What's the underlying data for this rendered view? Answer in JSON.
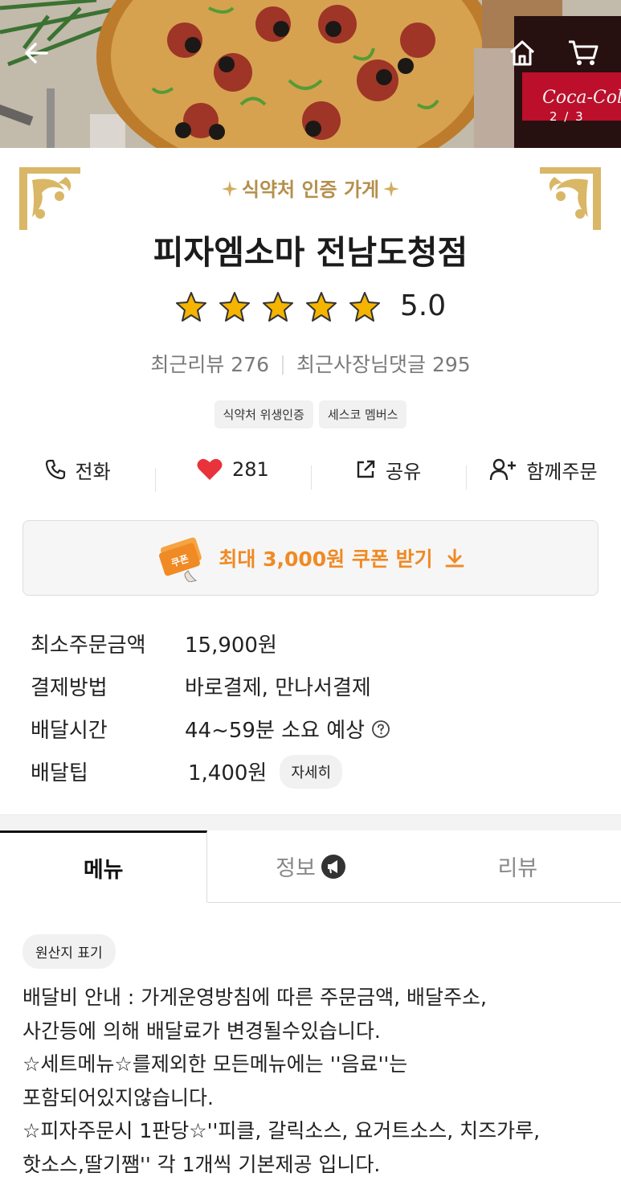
{
  "hero": {
    "image_counter": "2 / 3",
    "back_icon": "arrow-left-icon",
    "home_icon": "home-icon",
    "cart_icon": "cart-icon"
  },
  "store": {
    "certification": "식약처 인증 가게",
    "name": "피자엠소마 전남도청점",
    "rating_stars": 5,
    "rating": "5.0",
    "recent_reviews": "최근리뷰 276",
    "owner_replies": "최근사장님댓글 295",
    "badges": [
      "식약처 위생인증",
      "세스코 멤버스"
    ]
  },
  "actions": {
    "call": "전화",
    "likes": "281",
    "share": "공유",
    "group_order": "함께주문"
  },
  "coupon": {
    "label": "최대 3,000원 쿠폰 받기",
    "ticket_text": "쿠폰"
  },
  "info": {
    "min_order_key": "최소주문금액",
    "min_order_val": "15,900원",
    "payment_key": "결제방법",
    "payment_val": "바로결제, 만나서결제",
    "delivery_time_key": "배달시간",
    "delivery_time_val": "44~59분 소요 예상",
    "delivery_tip_key": "배달팁",
    "delivery_tip_val": "1,400원",
    "detail_button": "자세히"
  },
  "tabs": {
    "menu": "메뉴",
    "info": "정보",
    "review": "리뷰"
  },
  "notice": {
    "origin_chip": "원산지 표기",
    "text": "배달비 안내 :  가게운영방침에 따른 주문금액, 배달주소,\n사간등에 의해 배달료가 변경될수있습니다.\n☆세트메뉴☆를제외한 모든메뉴에는 ''음료''는\n포함되어있지않습니다.\n☆피자주문시 1판당☆''피클, 갈릭소스, 요거트소스, 치즈가루,\n핫소스,딸기쨈'' 각 1개씩 기본제공 입니다."
  },
  "colors": {
    "accent_orange": "#f08a24",
    "gold": "#b48f4c",
    "heart": "#e8333a",
    "star": "#f5b400"
  }
}
